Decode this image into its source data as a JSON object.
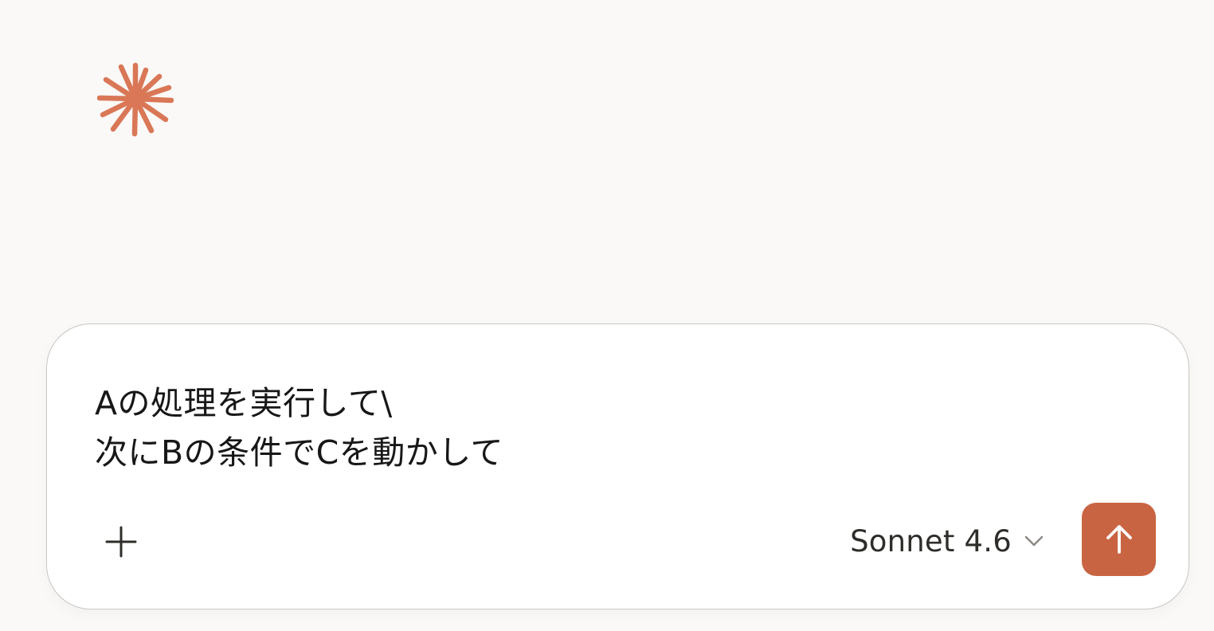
{
  "brand": {
    "logo_icon": "claude-starburst-icon",
    "accent_color": "#d97757"
  },
  "composer": {
    "input_value": "Aの処理を実行して\\\n次にBの条件でCを動かして",
    "attach_icon": "plus-icon",
    "model_label": "Sonnet 4.6",
    "model_icon": "chevron-down-icon",
    "send_icon": "arrow-up-icon",
    "send_color": "#c96442"
  }
}
